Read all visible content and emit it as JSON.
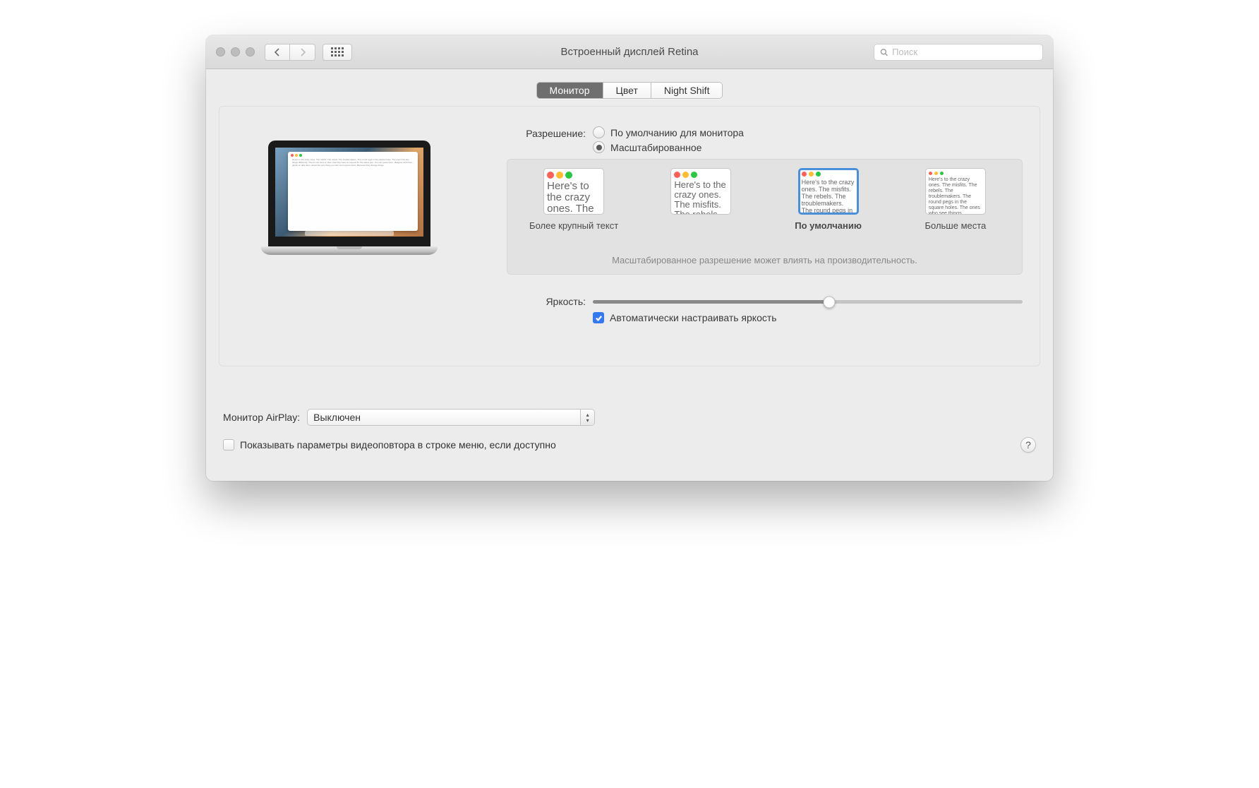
{
  "window": {
    "title": "Встроенный дисплей Retina",
    "search_placeholder": "Поиск"
  },
  "tabs": {
    "t0": "Монитор",
    "t1": "Цвет",
    "t2": "Night Shift",
    "active": 0
  },
  "resolution": {
    "label": "Разрешение:",
    "opt_default": "По умолчанию для монитора",
    "opt_scaled": "Масштабированное",
    "selected": "scaled"
  },
  "scaling": {
    "thumbs": {
      "0": "Более крупный текст",
      "1": "",
      "2": "По умолчанию",
      "3": "Больше места"
    },
    "sample_text": "Here's to the crazy ones. The misfits. The rebels. The troublemakers. The round pegs in the square holes. The ones who see things differently. They're not fond of rules. And they have no respect for the status quo. You can quote them, disagree with them, glorify or vilify them. About the only thing you can't do is ignore them. Because they change things.",
    "selected_index": 2,
    "perf_note": "Масштабированное разрешение может влиять на производительность."
  },
  "brightness": {
    "label": "Яркость:",
    "value_pct": 55,
    "auto_checked": true,
    "auto_label": "Автоматически настраивать яркость"
  },
  "airplay": {
    "label": "Монитор AirPlay:",
    "value": "Выключен"
  },
  "mirror": {
    "checked": false,
    "label": "Показывать параметры видеоповтора в строке меню, если доступно"
  },
  "help_tooltip": "?"
}
